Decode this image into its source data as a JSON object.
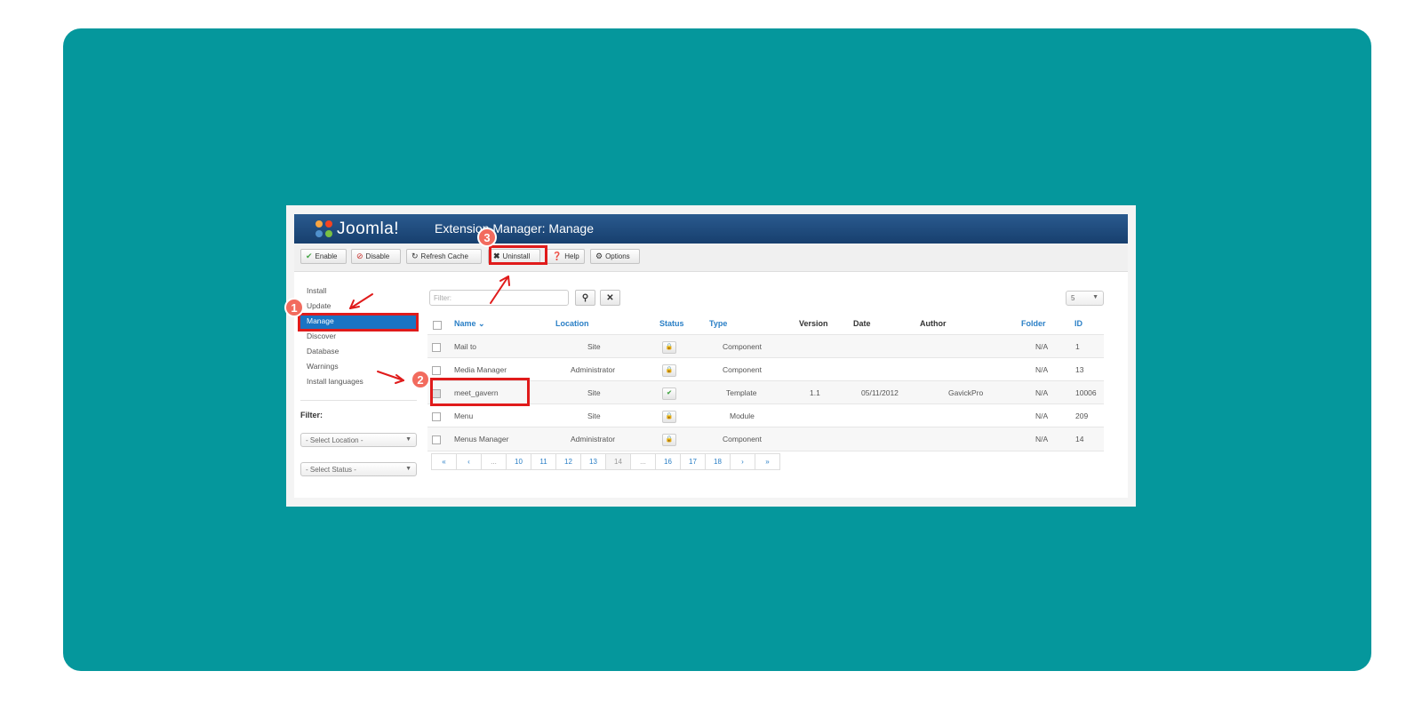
{
  "header": {
    "logo_text": "Joomla!",
    "title": "Extension Manager: Manage"
  },
  "toolbar": {
    "enable": "Enable",
    "disable": "Disable",
    "refresh": "Refresh Cache",
    "uninstall": "Uninstall",
    "help": "Help",
    "options": "Options"
  },
  "sidebar": {
    "items": [
      "Install",
      "Update",
      "Manage",
      "Discover",
      "Database",
      "Warnings",
      "Install languages"
    ],
    "active": "Manage",
    "filter_label": "Filter:",
    "select_location": "- Select Location -",
    "select_status": "- Select Status -"
  },
  "search": {
    "placeholder": "Filter:",
    "limit": "5"
  },
  "table": {
    "headers": [
      "Name",
      "Location",
      "Status",
      "Type",
      "Version",
      "Date",
      "Author",
      "Folder",
      "ID"
    ],
    "rows": [
      {
        "name": "Mail to",
        "location": "Site",
        "status": "locked",
        "type": "Component",
        "version": "",
        "date": "",
        "author": "",
        "folder": "N/A",
        "id": "1"
      },
      {
        "name": "Media Manager",
        "location": "Administrator",
        "status": "locked",
        "type": "Component",
        "version": "",
        "date": "",
        "author": "",
        "folder": "N/A",
        "id": "13"
      },
      {
        "name": "meet_gavern",
        "location": "Site",
        "status": "enabled",
        "type": "Template",
        "version": "1.1",
        "date": "05/11/2012",
        "author": "GavickPro",
        "folder": "N/A",
        "id": "10006"
      },
      {
        "name": "Menu",
        "location": "Site",
        "status": "locked",
        "type": "Module",
        "version": "",
        "date": "",
        "author": "",
        "folder": "N/A",
        "id": "209"
      },
      {
        "name": "Menus Manager",
        "location": "Administrator",
        "status": "locked",
        "type": "Component",
        "version": "",
        "date": "",
        "author": "",
        "folder": "N/A",
        "id": "14"
      }
    ]
  },
  "pagination": [
    "«",
    "‹",
    "...",
    "10",
    "11",
    "12",
    "13",
    "14",
    "...",
    "16",
    "17",
    "18",
    "›",
    "»"
  ],
  "pagination_current": "14",
  "annotations": {
    "marker1": "1",
    "marker2": "2",
    "marker3": "3"
  },
  "colors": {
    "background": "#05979c",
    "highlight": "#e01b1b",
    "marker": "#f26b5e",
    "header": "#1e4a7e",
    "active": "#1a74c4"
  }
}
